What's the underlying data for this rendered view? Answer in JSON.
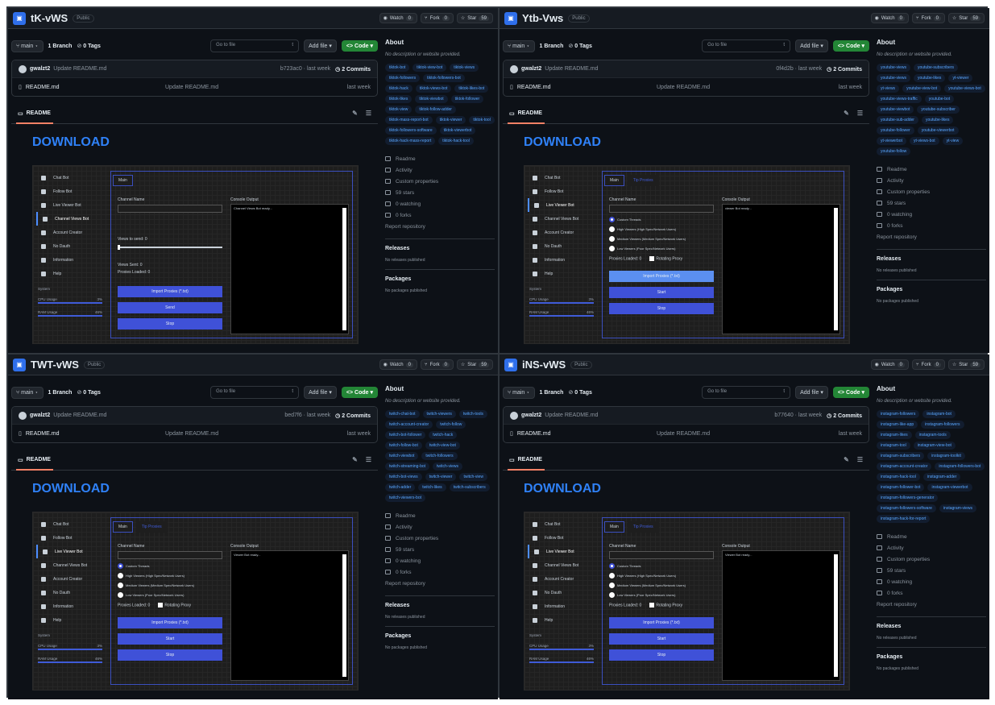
{
  "common": {
    "public_badge": "Public",
    "watch_label": "Watch",
    "watch_count": "0",
    "fork_label": "Fork",
    "fork_count": "0",
    "star_label": "Star",
    "star_count": "59",
    "branch": "main",
    "branch_count_label": "1 Branch",
    "tags_label": "0 Tags",
    "goto_placeholder": "Go to file",
    "goto_shortcut": "t",
    "add_file": "Add file",
    "code": "Code",
    "commit_author": "gwalzt2",
    "commit_msg": "Update README.md",
    "commits": "2 Commits",
    "file_name": "README.md",
    "file_time": "last week",
    "readme_tab": "README",
    "download": "DOWNLOAD",
    "about": "About",
    "no_desc": "No description or website provided.",
    "readme_link": "Readme",
    "activity": "Activity",
    "custom_props": "Custom properties",
    "stars_link": "59 stars",
    "watching_link": "0 watching",
    "forks_link": "0 forks",
    "report": "Report repository",
    "releases": "Releases",
    "no_releases": "No releases published",
    "packages": "Packages",
    "no_packages": "No packages published",
    "nav": [
      "Chat Bot",
      "Follow Bot",
      "Live Viewer Bot",
      "Channel Views Bot",
      "Account Creator",
      "No Dauth",
      "Information",
      "Help"
    ],
    "system": "System",
    "cpu": "CPU Usage",
    "cpu_val": "3%",
    "ram": "RAM Usage",
    "ram_val": "46%",
    "channel_name": "Channel Name",
    "console": "Console Output",
    "import": "Import Proxies (*.txt)",
    "send": "Send",
    "start": "Start",
    "stop": "Stop",
    "main_tab": "Main",
    "proxy_tab": "Tip Proxies",
    "custom_threads": "Custom Threads",
    "high": "High Viewers (High Spec/Network Users)",
    "medium": "Medium Viewers (Medium Spec/Network Users)",
    "low": "Low Viewers (Poor Spec/Network Users)",
    "proxies_loaded": "Proxies Loaded: 0",
    "rotating": "Rotating Proxy"
  },
  "panels": [
    {
      "repo": "tK-vWS",
      "commit_hash": "b723ac0 · last week",
      "topics": [
        "tiktok-bot",
        "tiktok-view-bot",
        "tiktok-views",
        "tiktok-followers",
        "tiktok-followers-bot",
        "tiktok-hack",
        "tiktok-views-bot",
        "tiktok-likes-bot",
        "tiktok-likes",
        "tiktok-viewbot",
        "tiktok-follower",
        "tiktok-view",
        "tiktok-follow-adder",
        "tiktok-mass-report-bot",
        "tiktok-viewer",
        "tiktok-tool",
        "tiktok-followers-software",
        "tiktok-viewerbot",
        "tiktok-hack-mass-report",
        "tiktok-hack-tool"
      ],
      "console_text": "Channel Views Bot ready...",
      "views_label": "Views to send: 0",
      "views_sent": "Views Sent: 0",
      "proxies_line": "Proxies Loaded: 0"
    },
    {
      "repo": "Ytb-Vws",
      "commit_hash": "0f4d2b · last week",
      "topics": [
        "youtube-views",
        "youtube-subscribers",
        "youtube-views",
        "youtube-likes",
        "yt-viewer",
        "yt-views",
        "youtube-view-bot",
        "youtube-views-bot",
        "youtube-views-traffic",
        "youtube-bot",
        "youtube-viewbot",
        "youtube-subscriber",
        "youtube-sub-adder",
        "youtube-likes",
        "youtube-follower",
        "youtube-viewerbot",
        "yt-viewerbot",
        "yt-views-bot",
        "yt-view",
        "youtube-follow"
      ],
      "console_text": "viewer Bot ready..."
    },
    {
      "repo": "TWT-vWS",
      "commit_hash": "bed7f6 · last week",
      "topics": [
        "twitch-chat-bot",
        "twitch-viewers",
        "twitch-tools",
        "twitch-account-creator",
        "twitch-follow",
        "twitch-bot-follower",
        "twitch-hack",
        "twitch-follow-bot",
        "twitch-view-bot",
        "twitch-viewbot",
        "twitch-followers",
        "twitch-streaming-bot",
        "twitch-views",
        "twitch-bot-views",
        "twitch-viewer",
        "twitch-view",
        "twitch-adder",
        "twitch-likes",
        "twitch-subscribers",
        "twitch-viewers-bot"
      ],
      "console_text": "Viewer Bot ready..."
    },
    {
      "repo": "iNS-vWS",
      "commit_hash": "b77640 · last week",
      "topics": [
        "instagram-followers",
        "instagram-bot",
        "instagram-like-app",
        "instagram-followers",
        "instagram-likes",
        "instagram-tools",
        "instagram-tool",
        "instagram-view-bot",
        "instagram-subscribers",
        "instagram-toolkit",
        "instagram-account-creator",
        "instagram-followers-bot",
        "instagram-hack-tool",
        "instagram-adder",
        "instagram-follower-bot",
        "instagram-viewerbot",
        "instagram-followers-generator",
        "instagram-followers-software",
        "instagram-views",
        "instagram-hack-for-report"
      ],
      "console_text": "Viewer Bot ready..."
    }
  ]
}
